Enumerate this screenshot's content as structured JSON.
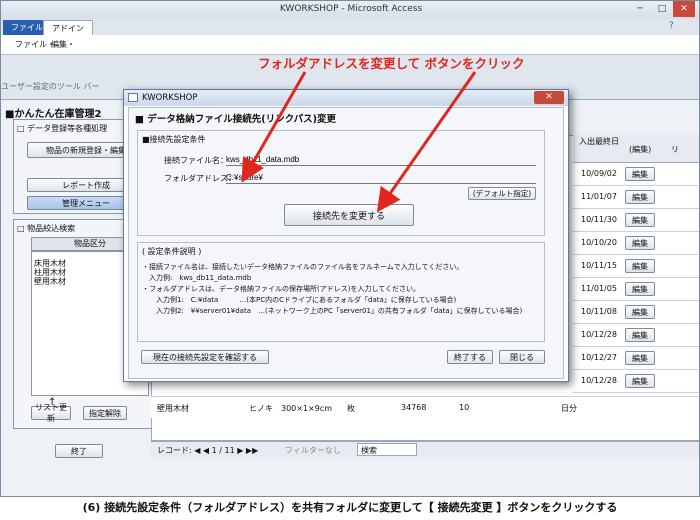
{
  "window": {
    "title": "KWORKSHOP - Microsoft Access",
    "tabs": [
      "ファイル",
      "アドイン"
    ],
    "menu": [
      "ファイル・",
      "編集・"
    ],
    "toolbar_label": "ユーザー設定のツール バー"
  },
  "form": {
    "title": "■かんたん在庫管理2",
    "section1": "□ データ登録等各種処理",
    "btn_new_item": "物品の新規登録・編集",
    "btn_report": "レポート作成",
    "btn_manage": "管理メニュー",
    "section2": "□ 物品絞込検索",
    "category_header": "物品区分",
    "categories": [
      "床用木材",
      "柱用木材",
      "壁用木材"
    ],
    "btn_list_update": "リスト更新",
    "btn_clear": "指定解除",
    "btn_exit": "終了",
    "grid_header_date": "入出最終日",
    "grid_header_edit": "(編集)",
    "rows": [
      {
        "date": "10/09/02",
        "edit": "編集"
      },
      {
        "date": "11/01/07",
        "edit": "編集"
      },
      {
        "date": "10/11/30",
        "edit": "編集"
      },
      {
        "date": "10/10/20",
        "edit": "編集"
      },
      {
        "date": "10/11/15",
        "edit": "編集"
      },
      {
        "date": "11/01/05",
        "edit": "編集"
      },
      {
        "date": "10/11/08",
        "edit": "編集"
      },
      {
        "date": "10/12/28",
        "edit": "編集"
      },
      {
        "date": "10/12/27",
        "edit": "編集"
      },
      {
        "date": "10/12/28",
        "edit": "編集"
      }
    ],
    "last_row": {
      "name": "壁用木材",
      "spec": "ヒノキ　300×1×9cm",
      "unit": "枚",
      "qty": "34768",
      "n": "10",
      "day": "日分"
    },
    "record_nav": "レコード: ◀  ◀  1 / 11  ▶  ▶▶",
    "filter": "フィルターなし",
    "search": "検索"
  },
  "dialog": {
    "title": "KWORKSHOP",
    "heading": "■ データ格納ファイル接続先(リンクパス)変更",
    "group_label": "■接続先設定条件",
    "filename_label": "接続ファイル名：",
    "filename_value": "kws_db11_data.mdb",
    "folder_label": "フォルダアドレス：",
    "folder_value": "C:¥share¥",
    "default_button": "(デフォルト指定)",
    "change_button": "接続先を変更する",
    "expl_title": "( 設定条件説明 )",
    "expl_lines": [
      "・接続ファイル名は、接続したいデータ格納ファイルのファイル名をフルネームで入力してください。",
      "　入力例:　kws_db11_data.mdb",
      "・フォルダアドレスは、データ格納ファイルの保存場所(アドレス)を入力してください。",
      "　　入力例1:　C:¥data　　　…(本PC内のCドライブにあるフォルダ「data」に保存している場合)",
      "　　入力例2:　¥¥server01¥data　…(ネットワーク上のPC「server01」の共有フォルダ「data」に保存している場合)"
    ],
    "check_button": "現在の接続先設定を確認する",
    "finish_button": "終了する",
    "close_button": "閉じる"
  },
  "annotation": "フォルダアドレスを変更して ボタンをクリック",
  "caption": "(6) 接続先設定条件（フォルダアドレス）を共有フォルダに変更して【 接続先変更 】ボタンをクリックする"
}
